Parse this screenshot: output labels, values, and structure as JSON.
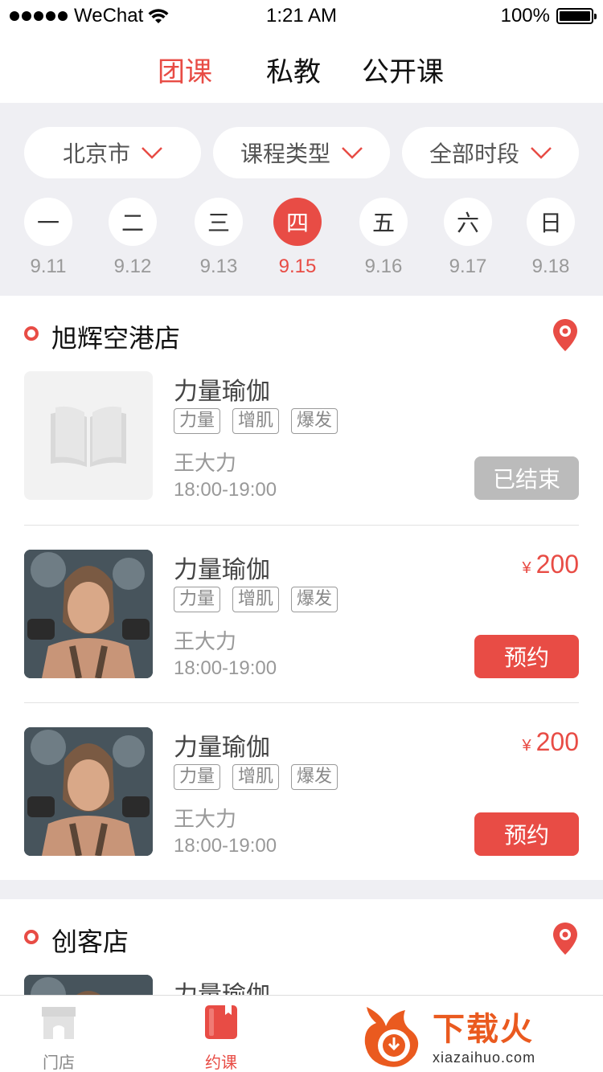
{
  "status_bar": {
    "carrier": "WeChat",
    "time": "1:21 AM",
    "battery": "100%"
  },
  "tabs": [
    {
      "label": "团课",
      "active": true
    },
    {
      "label": "私教",
      "active": false
    },
    {
      "label": "公开课",
      "active": false
    }
  ],
  "filters": [
    {
      "label": "北京市",
      "icon": "chevron-down-icon"
    },
    {
      "label": "课程类型",
      "icon": "chevron-down-icon"
    },
    {
      "label": "全部时段",
      "icon": "chevron-down-icon"
    }
  ],
  "days": [
    {
      "weekday": "一",
      "date": "9.11",
      "active": false
    },
    {
      "weekday": "二",
      "date": "9.12",
      "active": false
    },
    {
      "weekday": "三",
      "date": "9.13",
      "active": false
    },
    {
      "weekday": "四",
      "date": "9.15",
      "active": true
    },
    {
      "weekday": "五",
      "date": "9.16",
      "active": false
    },
    {
      "weekday": "六",
      "date": "9.17",
      "active": false
    },
    {
      "weekday": "日",
      "date": "9.18",
      "active": false
    }
  ],
  "stores": [
    {
      "name": "旭辉空港店",
      "courses": [
        {
          "title": "力量瑜伽",
          "tags": [
            "力量",
            "增肌",
            "爆发"
          ],
          "teacher": "王大力",
          "time": "18:00-19:00",
          "price_symbol": "",
          "price": "",
          "button": "已结束",
          "image": "book-placeholder-icon"
        },
        {
          "title": "力量瑜伽",
          "tags": [
            "力量",
            "增肌",
            "爆发"
          ],
          "teacher": "王大力",
          "time": "18:00-19:00",
          "price_symbol": "¥",
          "price": "200",
          "button": "预约",
          "image": "fitness-photo"
        },
        {
          "title": "力量瑜伽",
          "tags": [
            "力量",
            "增肌",
            "爆发"
          ],
          "teacher": "王大力",
          "time": "18:00-19:00",
          "price_symbol": "¥",
          "price": "200",
          "button": "预约",
          "image": "fitness-photo"
        }
      ]
    },
    {
      "name": "创客店",
      "courses": [
        {
          "title": "力量瑜伽",
          "image": "fitness-photo"
        }
      ]
    }
  ],
  "bottom_nav": [
    {
      "label": "门店",
      "icon": "store-icon",
      "active": false
    },
    {
      "label": "约课",
      "icon": "book-course-icon",
      "active": true
    }
  ],
  "watermark": {
    "title": "下载火",
    "url": "xiazaihuo.com"
  },
  "colors": {
    "accent": "#e84c45",
    "background": "#efeff3",
    "ended_button": "#bbbbbb"
  }
}
